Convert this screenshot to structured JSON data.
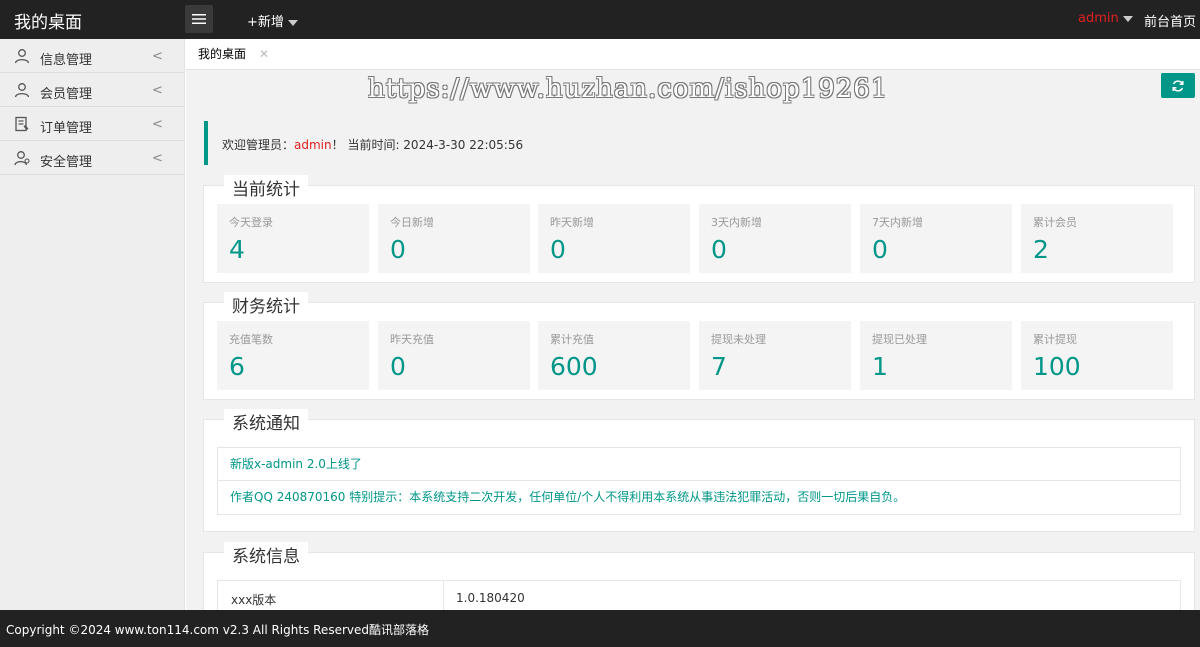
{
  "header": {
    "logo": "我的桌面",
    "add_new": "+新增",
    "user": "admin",
    "home": "前台首页"
  },
  "sidebar": {
    "items": [
      {
        "label": "信息管理",
        "icon": "user-icon",
        "arrow": "<"
      },
      {
        "label": "会员管理",
        "icon": "user-icon",
        "arrow": "<"
      },
      {
        "label": "订单管理",
        "icon": "order-icon",
        "arrow": "<"
      },
      {
        "label": "安全管理",
        "icon": "security-user-icon",
        "arrow": "<"
      }
    ]
  },
  "tabs": [
    {
      "label": "我的桌面",
      "close": "✕"
    }
  ],
  "watermark": "https://www.huzhan.com/ishop19261",
  "welcome": {
    "prefix": "欢迎管理员：",
    "admin": "admin",
    "suffix": "！ 当前时间: 2024-3-30 22:05:56"
  },
  "current_stats": {
    "title": "当前统计",
    "cards": [
      {
        "label": "今天登录",
        "value": "4"
      },
      {
        "label": "今日新增",
        "value": "0"
      },
      {
        "label": "昨天新增",
        "value": "0"
      },
      {
        "label": "3天内新增",
        "value": "0"
      },
      {
        "label": "7天内新增",
        "value": "0"
      },
      {
        "label": "累计会员",
        "value": "2"
      }
    ]
  },
  "finance_stats": {
    "title": "财务统计",
    "cards": [
      {
        "label": "充值笔数",
        "value": "6"
      },
      {
        "label": "昨天充值",
        "value": "0"
      },
      {
        "label": "累计充值",
        "value": "600"
      },
      {
        "label": "提现未处理",
        "value": "7"
      },
      {
        "label": "提现已处理",
        "value": "1"
      },
      {
        "label": "累计提现",
        "value": "100"
      }
    ]
  },
  "notice": {
    "title": "系统通知",
    "items": [
      "新版x-admin 2.0上线了",
      "作者QQ 240870160 特别提示：本系统支持二次开发，任何单位/个人不得利用本系统从事违法犯罪活动，否则一切后果自负。"
    ]
  },
  "sysinfo": {
    "title": "系统信息",
    "rows": [
      {
        "key": "xxx版本",
        "value": "1.0.180420"
      }
    ]
  },
  "footer": {
    "text": "Copyright ©2024 www.ton114.com v2.3 All Rights Reserved酷讯部落格"
  },
  "colors": {
    "accent": "#009688",
    "admin_red": "#e02020",
    "header_bg": "#222222"
  }
}
